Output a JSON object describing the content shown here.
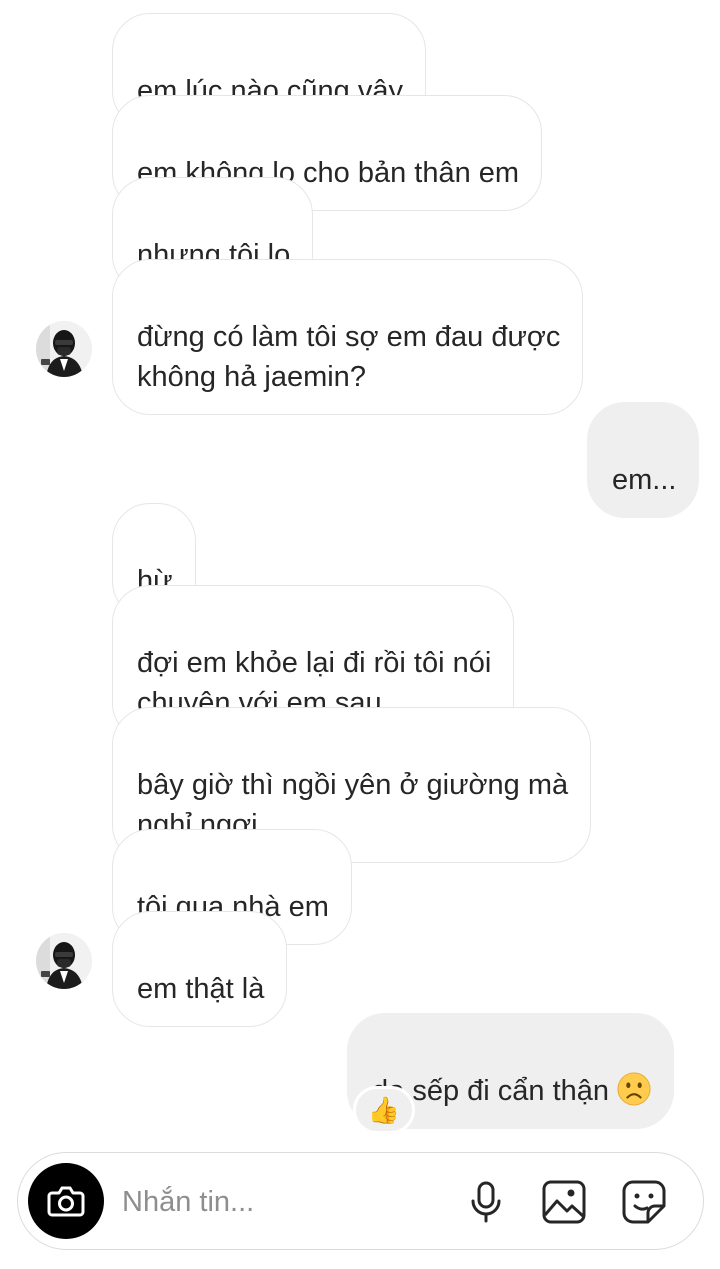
{
  "thread": {
    "messages": [
      {
        "side": "received",
        "text": "em lúc nào cũng vậy"
      },
      {
        "side": "received",
        "text": "em không lo cho bản thân em"
      },
      {
        "side": "received",
        "text": "nhưng tôi lo"
      },
      {
        "side": "received",
        "text": "đừng có làm tôi sợ em đau được\nkhông hả jaemin?"
      },
      {
        "side": "sent",
        "text": "em..."
      },
      {
        "side": "received",
        "text": "hừ"
      },
      {
        "side": "received",
        "text": "đợi em khỏe lại đi rồi tôi nói\nchuyện với em sau"
      },
      {
        "side": "received",
        "text": "bây giờ thì ngồi yên ở giường mà\nnghỉ ngơi"
      },
      {
        "side": "received",
        "text": "tôi qua nhà em"
      },
      {
        "side": "received",
        "text": "em thật là"
      },
      {
        "side": "sent",
        "text": "dạ sếp đi cẩn thận",
        "emoji": "sad-face-icon"
      }
    ],
    "reaction": {
      "emoji": "👍",
      "icon": "thumbs-up-icon"
    }
  },
  "composer": {
    "placeholder": "Nhắn tin...",
    "value": "",
    "icons": [
      "camera-icon",
      "microphone-icon",
      "gallery-icon",
      "sticker-icon"
    ]
  },
  "colors": {
    "received_bubble_border": "#e6e6e6",
    "sent_bubble_bg": "#efefef",
    "text": "#262626",
    "placeholder": "#8e8e8e",
    "camera_button": "#000000",
    "emoji_yellow": "#ffcc4d"
  }
}
